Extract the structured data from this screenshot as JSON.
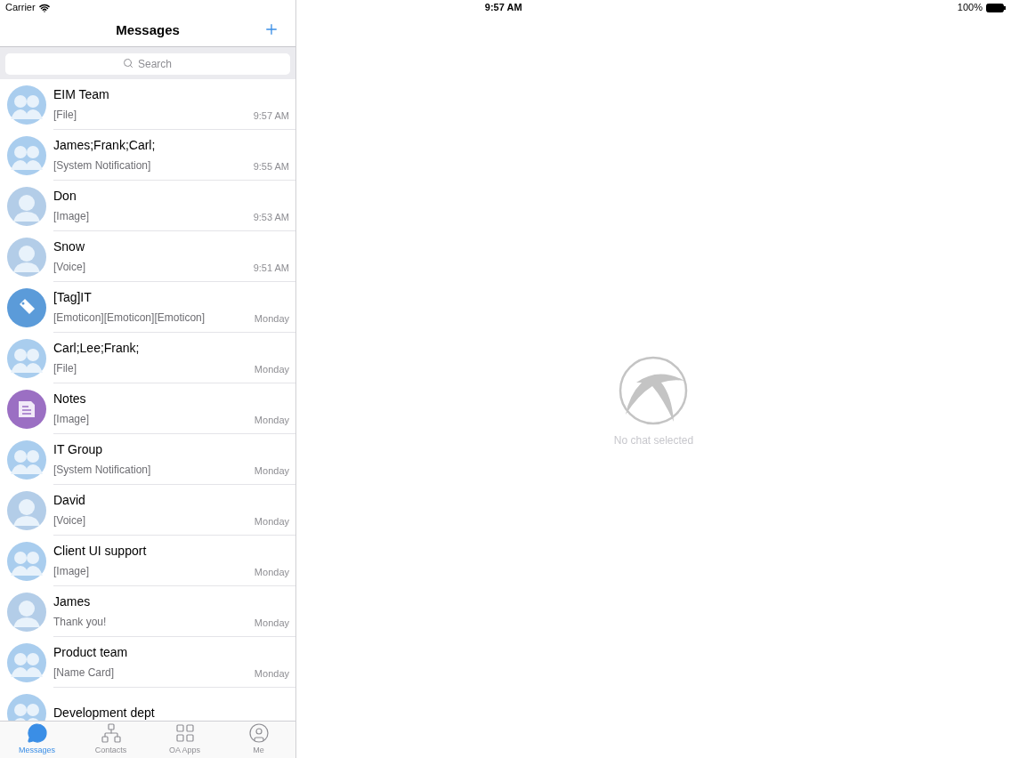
{
  "status_bar": {
    "carrier": "Carrier",
    "time": "9:57 AM",
    "battery": "100%"
  },
  "sidebar": {
    "title": "Messages",
    "search": {
      "placeholder": "Search"
    },
    "conversations": [
      {
        "name": "EIM Team",
        "preview": "[File]",
        "time": "9:57 AM",
        "kind": "group"
      },
      {
        "name": "James;Frank;Carl;",
        "preview": "[System Notification]",
        "time": "9:55 AM",
        "kind": "group"
      },
      {
        "name": "Don",
        "preview": "[Image]",
        "time": "9:53 AM",
        "kind": "person"
      },
      {
        "name": "Snow",
        "preview": "[Voice]",
        "time": "9:51 AM",
        "kind": "person"
      },
      {
        "name": "[Tag]IT",
        "preview": "[Emoticon][Emoticon][Emoticon]",
        "time": "Monday",
        "kind": "tag"
      },
      {
        "name": "Carl;Lee;Frank;",
        "preview": "[File]",
        "time": "Monday",
        "kind": "group"
      },
      {
        "name": "Notes",
        "preview": "[Image]",
        "time": "Monday",
        "kind": "notes"
      },
      {
        "name": "IT Group",
        "preview": "[System Notification]",
        "time": "Monday",
        "kind": "group"
      },
      {
        "name": "David",
        "preview": "[Voice]",
        "time": "Monday",
        "kind": "person"
      },
      {
        "name": "Client UI support",
        "preview": "[Image]",
        "time": "Monday",
        "kind": "group"
      },
      {
        "name": "James",
        "preview": "Thank you!",
        "time": "Monday",
        "kind": "person"
      },
      {
        "name": "Product team",
        "preview": "[Name Card]",
        "time": "Monday",
        "kind": "group"
      },
      {
        "name": "Development dept",
        "kind": "group"
      }
    ],
    "tabs": [
      {
        "label": "Messages",
        "selected": true
      },
      {
        "label": "Contacts",
        "selected": false
      },
      {
        "label": "OA Apps",
        "selected": false
      },
      {
        "label": "Me",
        "selected": false
      }
    ]
  },
  "detail": {
    "empty_text": "No chat selected"
  }
}
